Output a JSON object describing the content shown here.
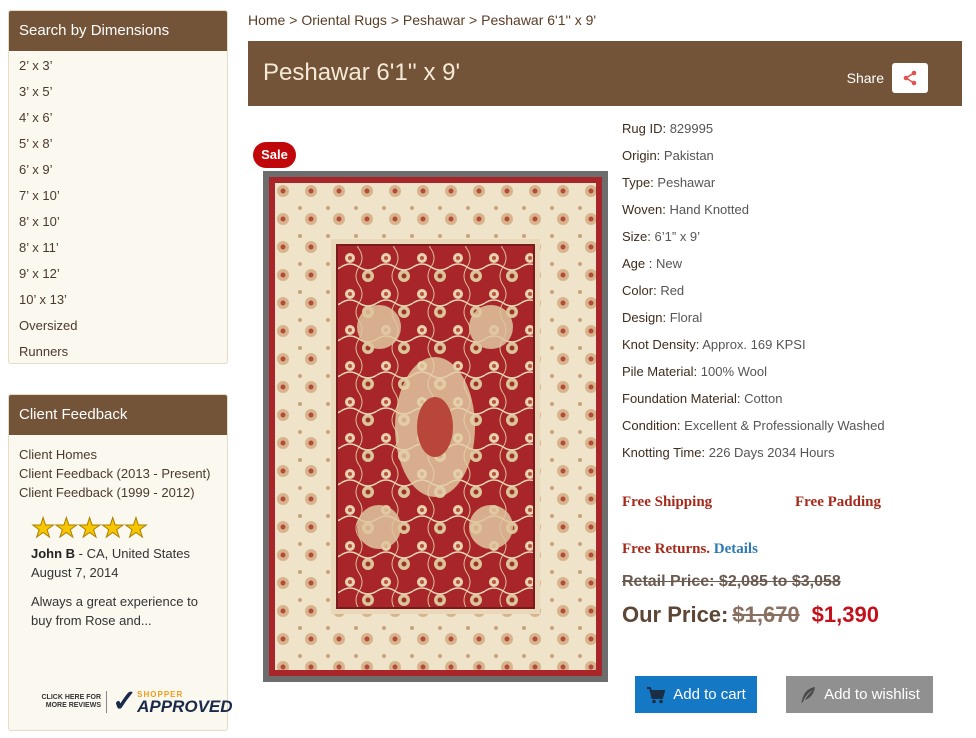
{
  "sidebar": {
    "dimensions": {
      "title": "Search by Dimensions",
      "items": [
        "2’ x 3’",
        "3’ x 5’",
        "4’ x 6’",
        "5’ x 8’",
        "6’ x 9’",
        "7’ x 10’",
        "8’ x 10’",
        "8’ x 11’",
        "9’ x 12’",
        "10’ x 13’",
        "Oversized",
        "Runners"
      ]
    },
    "feedback": {
      "title": "Client Feedback",
      "links": [
        "Client Homes",
        "Client Feedback (2013 - Present)",
        "Client Feedback (1999 - 2012)"
      ],
      "rating_stars": 5,
      "reviewer_name": "John B",
      "reviewer_location": " - CA, United States",
      "review_date": "August 7, 2014",
      "review_text": "Always a great experience to buy from Rose and...",
      "badge_small_text": "CLICK HERE FOR MORE REVIEWS",
      "badge_top": "SHOPPER",
      "badge_brand": "APPROVED"
    }
  },
  "breadcrumb": {
    "items": [
      "Home",
      "Oriental Rugs",
      "Peshawar",
      "Peshawar 6'1'' x 9'"
    ],
    "separator": ">"
  },
  "product": {
    "title": "Peshawar 6'1'' x 9'",
    "share_label": "Share",
    "sale_badge": "Sale",
    "specs": [
      {
        "key": "Rug ID:",
        "value": "829995"
      },
      {
        "key": "Origin:",
        "value": "Pakistan"
      },
      {
        "key": "Type:",
        "value": "Peshawar"
      },
      {
        "key": "Woven:",
        "value": "Hand Knotted"
      },
      {
        "key": "Size:",
        "value": "6’1” x 9’"
      },
      {
        "key": "Age :",
        "value": "New"
      },
      {
        "key": "Color:",
        "value": "Red"
      },
      {
        "key": "Design:",
        "value": "Floral"
      },
      {
        "key": "Knot Density:",
        "value": "Approx. 169 KPSI"
      },
      {
        "key": "Pile Material:",
        "value": "100% Wool"
      },
      {
        "key": "Foundation Material:",
        "value": "Cotton"
      },
      {
        "key": "Condition:",
        "value": "Excellent & Professionally Washed"
      },
      {
        "key": "Knotting Time:",
        "value": "226 Days 2034 Hours"
      }
    ],
    "perks": {
      "shipping": "Free Shipping",
      "padding": "Free Padding",
      "returns": "Free Returns.",
      "details_link": "Details"
    },
    "retail_price": "Retail Price: $2,085 to $3,058",
    "our_price_label": "Our Price:",
    "old_price": "$1,670",
    "new_price": "$1,390",
    "add_to_cart": "Add to cart",
    "add_to_wishlist": "Add to wishlist"
  },
  "colors": {
    "header_brown": "#735438",
    "panel_bg": "#fbf8ef",
    "sale_red": "#c0080a",
    "price_red": "#c4101b",
    "cart_blue": "#1578c5",
    "wishlist_gray": "#909090",
    "rug_field": "#a8262a",
    "rug_border": "#efe3c9"
  }
}
